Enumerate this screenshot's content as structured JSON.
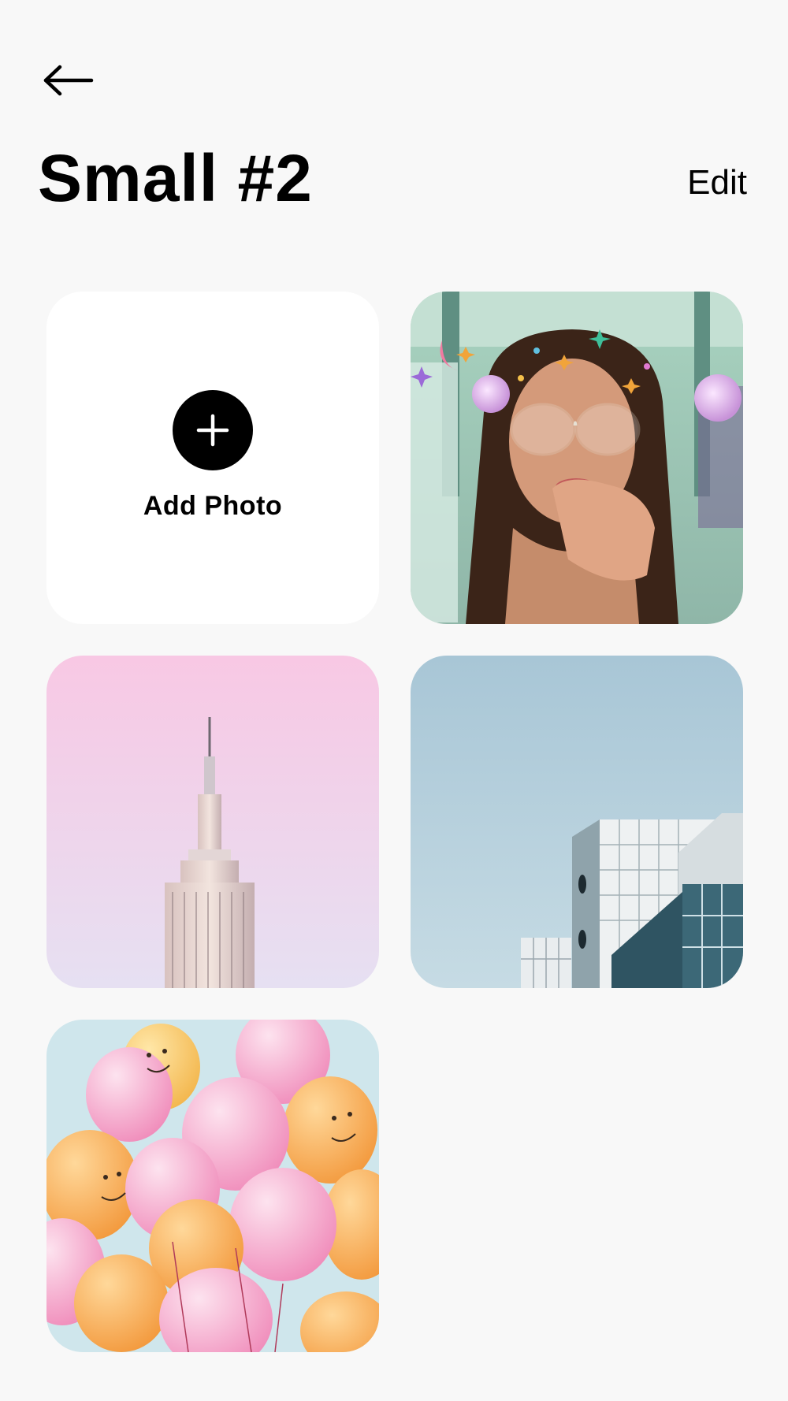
{
  "header": {
    "back_icon": "arrow-left-icon",
    "title": "Small #2",
    "edit_label": "Edit"
  },
  "grid": {
    "add_tile": {
      "icon": "plus-icon",
      "label": "Add Photo"
    },
    "photos": [
      {
        "subject": "woman-with-glasses-portrait"
      },
      {
        "subject": "skyscraper-pink-sky"
      },
      {
        "subject": "modern-building-blue-sky"
      },
      {
        "subject": "balloons"
      }
    ]
  },
  "colors": {
    "background": "#f8f8f8",
    "tile_background": "#ffffff",
    "accent": "#000000"
  }
}
